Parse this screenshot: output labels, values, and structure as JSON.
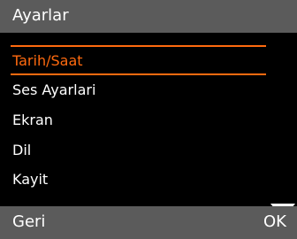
{
  "header": {
    "title": "Ayarlar"
  },
  "menu": {
    "items": [
      {
        "label": "Tarih/Saat",
        "selected": true
      },
      {
        "label": "Ses Ayarlari",
        "selected": false
      },
      {
        "label": "Ekran",
        "selected": false
      },
      {
        "label": "Dil",
        "selected": false
      },
      {
        "label": "Kayit",
        "selected": false
      }
    ]
  },
  "footer": {
    "left_softkey": "Geri",
    "right_softkey": "OK"
  },
  "icons": {
    "scroll": "scroll-down-arrow-icon"
  },
  "colors": {
    "bar_background": "#5b5b5b",
    "screen_background": "#000000",
    "accent": "#ff6a0f",
    "text": "#ffffff"
  }
}
